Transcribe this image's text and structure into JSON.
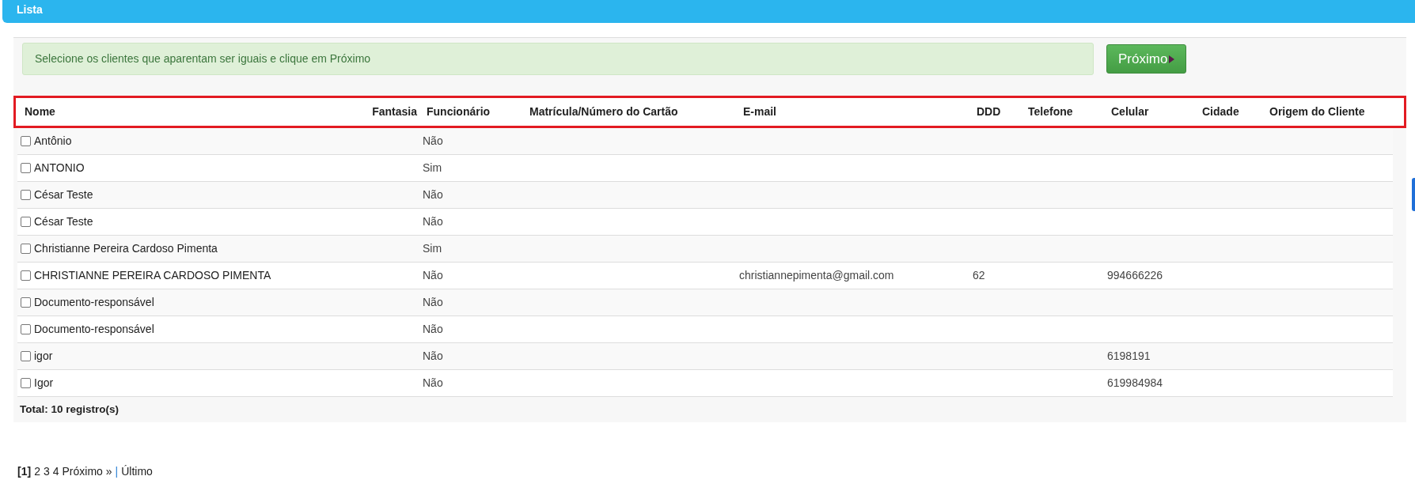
{
  "panel": {
    "title": "Lista"
  },
  "alert": {
    "text": "Selecione os clientes que aparentam ser iguais e clique em Próximo"
  },
  "next_button": {
    "label": "Próximo"
  },
  "table": {
    "header_highlighted": true,
    "columns": [
      "Nome",
      "Fantasia",
      "Funcionário",
      "Matrícula/Número do Cartão",
      "E-mail",
      "DDD",
      "Telefone",
      "Celular",
      "Cidade",
      "Origem do Cliente"
    ],
    "rows": [
      {
        "checked": false,
        "nome": "Antônio",
        "funcionario": "Não"
      },
      {
        "checked": false,
        "nome": "ANTONIO",
        "funcionario": "Sim"
      },
      {
        "checked": false,
        "nome": "César Teste",
        "funcionario": "Não"
      },
      {
        "checked": false,
        "nome": "César Teste",
        "funcionario": "Não"
      },
      {
        "checked": false,
        "nome": "Christianne Pereira Cardoso Pimenta",
        "funcionario": "Sim"
      },
      {
        "checked": false,
        "nome": "CHRISTIANNE PEREIRA CARDOSO PIMENTA",
        "funcionario": "Não",
        "email": "christiannepimenta@gmail.com",
        "ddd": "62",
        "celular": "994666226"
      },
      {
        "checked": false,
        "nome": "Documento-responsável",
        "funcionario": "Não"
      },
      {
        "checked": false,
        "nome": "Documento-responsável",
        "funcionario": "Não"
      },
      {
        "checked": false,
        "nome": "igor",
        "funcionario": "Não",
        "celular": "6198191"
      },
      {
        "checked": false,
        "nome": "Igor",
        "funcionario": "Não",
        "celular": "619984984"
      }
    ],
    "total": "Total: 10 registro(s)"
  },
  "pagination": {
    "pages": [
      {
        "label": "[1]",
        "selected": true
      },
      {
        "label": "2",
        "selected": false
      },
      {
        "label": "3",
        "selected": false
      },
      {
        "label": "4",
        "selected": false
      }
    ],
    "next": "Próximo »",
    "separator": "|",
    "last": "Último"
  }
}
